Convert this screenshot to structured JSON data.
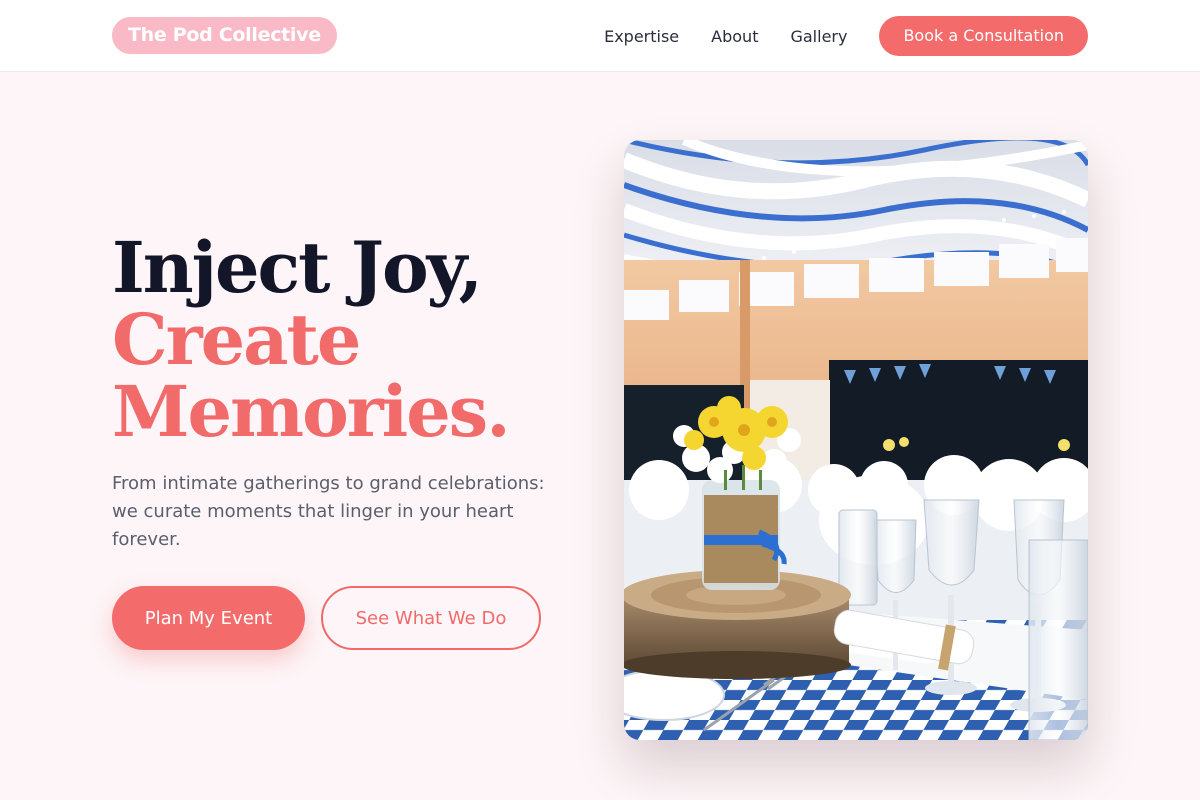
{
  "brand": {
    "name": "The Pod Collective"
  },
  "nav": {
    "links": [
      "Expertise",
      "About",
      "Gallery"
    ],
    "cta_label": "Book a Consultation"
  },
  "hero": {
    "title_line1": "Inject Joy,",
    "title_line2": "Create",
    "title_line3": "Memories.",
    "subtitle": "From intimate gatherings to grand celebrations: we curate moments that linger in your heart forever.",
    "primary_button": "Plan My Event",
    "secondary_button": "See What We Do",
    "image_subject": "decorated-banquet-hall-table-setting"
  },
  "colors": {
    "accent": "#f36b6b",
    "logo_bg": "#f9b9c6",
    "page_bg": "#fdf5f7",
    "heading": "#131528"
  }
}
